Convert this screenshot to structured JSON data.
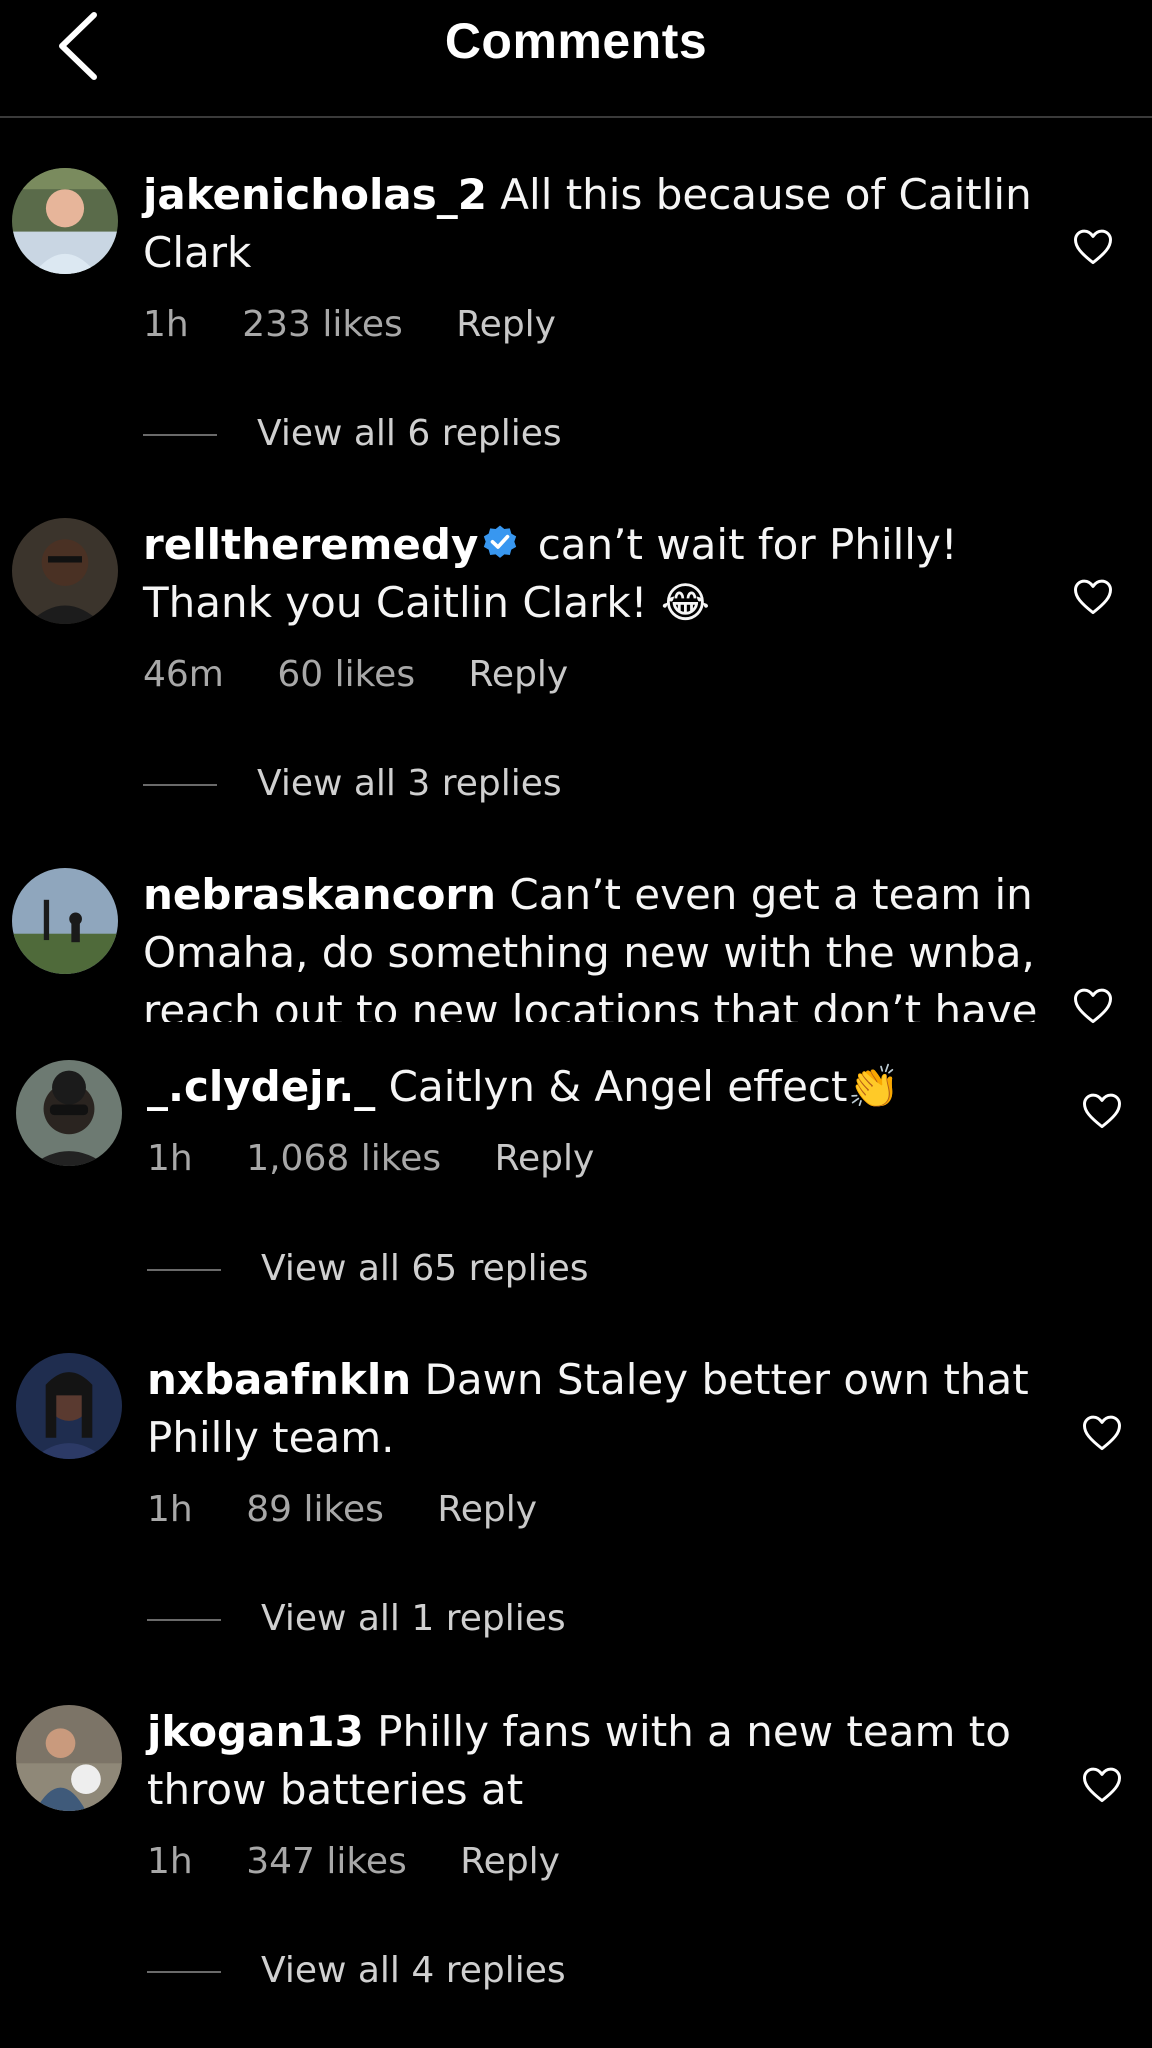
{
  "header": {
    "title": "Comments",
    "back_icon": "chevron-left-icon"
  },
  "comments": [
    {
      "username": "jakenicholas_2",
      "text": "All this because of Caitlin Clark",
      "time": "1h",
      "likes": "233 likes",
      "reply_label": "Reply",
      "view_replies": "View all 6 replies",
      "verified": false
    },
    {
      "username": "relltheremedy",
      "text": "can’t wait for Philly! Thank you Caitlin Clark! 😂",
      "time": "46m",
      "likes": "60 likes",
      "reply_label": "Reply",
      "view_replies": "View all 3 replies",
      "verified": true
    },
    {
      "username": "nebraskancorn",
      "text": "Can’t even get a team in Omaha, do something new with the wnba, reach out to new locations that don’t have",
      "verified": false
    },
    {
      "username": "_.clydejr._",
      "text": "Caitlyn & Angel effect👏",
      "time": "1h",
      "likes": "1,068 likes",
      "reply_label": "Reply",
      "view_replies": "View all 65 replies",
      "verified": false
    },
    {
      "username": "nxbaafnkln",
      "text": "Dawn Staley better own that Philly team.",
      "time": "1h",
      "likes": "89 likes",
      "reply_label": "Reply",
      "view_replies": "View all 1 replies",
      "verified": false
    },
    {
      "username": "jkogan13",
      "text": "Philly fans with a new team to throw batteries at",
      "time": "1h",
      "likes": "347 likes",
      "reply_label": "Reply",
      "view_replies": "View all 4 replies",
      "verified": false
    }
  ],
  "colors": {
    "background": "#000000",
    "text": "#ffffff",
    "muted": "#a8a8a8",
    "verified": "#3897f0"
  }
}
